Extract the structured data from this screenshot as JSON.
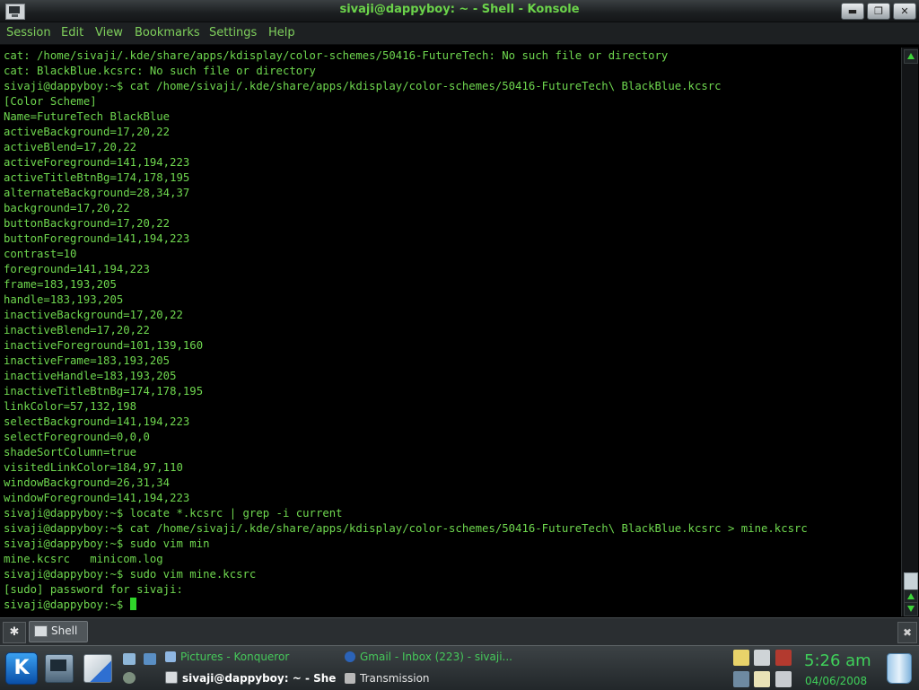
{
  "window": {
    "title": "sivaji@dappyboy: ~ - Shell - Konsole",
    "buttons": {
      "minimize": "▬",
      "maximize": "❐",
      "close": "✕"
    }
  },
  "menubar": {
    "items": [
      "Session",
      "Edit",
      "View",
      "Bookmarks",
      "Settings",
      "Help"
    ]
  },
  "terminal": {
    "lines": [
      "cat: /home/sivaji/.kde/share/apps/kdisplay/color-schemes/50416-FutureTech: No such file or directory",
      "cat: BlackBlue.kcsrc: No such file or directory",
      "sivaji@dappyboy:~$ cat /home/sivaji/.kde/share/apps/kdisplay/color-schemes/50416-FutureTech\\ BlackBlue.kcsrc",
      "[Color Scheme]",
      "Name=FutureTech BlackBlue",
      "activeBackground=17,20,22",
      "activeBlend=17,20,22",
      "activeForeground=141,194,223",
      "activeTitleBtnBg=174,178,195",
      "alternateBackground=28,34,37",
      "background=17,20,22",
      "buttonBackground=17,20,22",
      "buttonForeground=141,194,223",
      "contrast=10",
      "foreground=141,194,223",
      "frame=183,193,205",
      "handle=183,193,205",
      "inactiveBackground=17,20,22",
      "inactiveBlend=17,20,22",
      "inactiveForeground=101,139,160",
      "inactiveFrame=183,193,205",
      "inactiveHandle=183,193,205",
      "inactiveTitleBtnBg=174,178,195",
      "linkColor=57,132,198",
      "selectBackground=141,194,223",
      "selectForeground=0,0,0",
      "shadeSortColumn=true",
      "visitedLinkColor=184,97,110",
      "windowBackground=26,31,34",
      "windowForeground=141,194,223",
      "sivaji@dappyboy:~$ locate *.kcsrc | grep -i current",
      "sivaji@dappyboy:~$ cat /home/sivaji/.kde/share/apps/kdisplay/color-schemes/50416-FutureTech\\ BlackBlue.kcsrc > mine.kcsrc",
      "sivaji@dappyboy:~$ sudo vim min",
      "mine.kcsrc   minicom.log",
      "sivaji@dappyboy:~$ sudo vim mine.kcsrc",
      "[sudo] password for sivaji:"
    ],
    "prompt": "sivaji@dappyboy:~$ "
  },
  "tabbar": {
    "tabs": [
      {
        "label": "Shell",
        "icon": "terminal-icon"
      }
    ]
  },
  "taskbar": {
    "tasks_row1": [
      {
        "label": "Pictures - Konqueror",
        "icon": "folder-icon"
      },
      {
        "label": "Gmail - Inbox (223) - sivaji...",
        "icon": "firefox-icon"
      }
    ],
    "tasks_row2": [
      {
        "label": "sivaji@dappyboy: ~ - She",
        "icon": "terminal-icon"
      },
      {
        "label": "Transmission",
        "icon": "transmission-icon"
      }
    ]
  },
  "clock": {
    "time": "5:26 am",
    "date": "04/06/2008"
  },
  "colors": {
    "terminal_text": "#6fd84f",
    "title_text": "#6bd34a",
    "menu_text": "#7fd05c",
    "clock_text": "#3fd05a",
    "cursor": "#2fd52a"
  }
}
